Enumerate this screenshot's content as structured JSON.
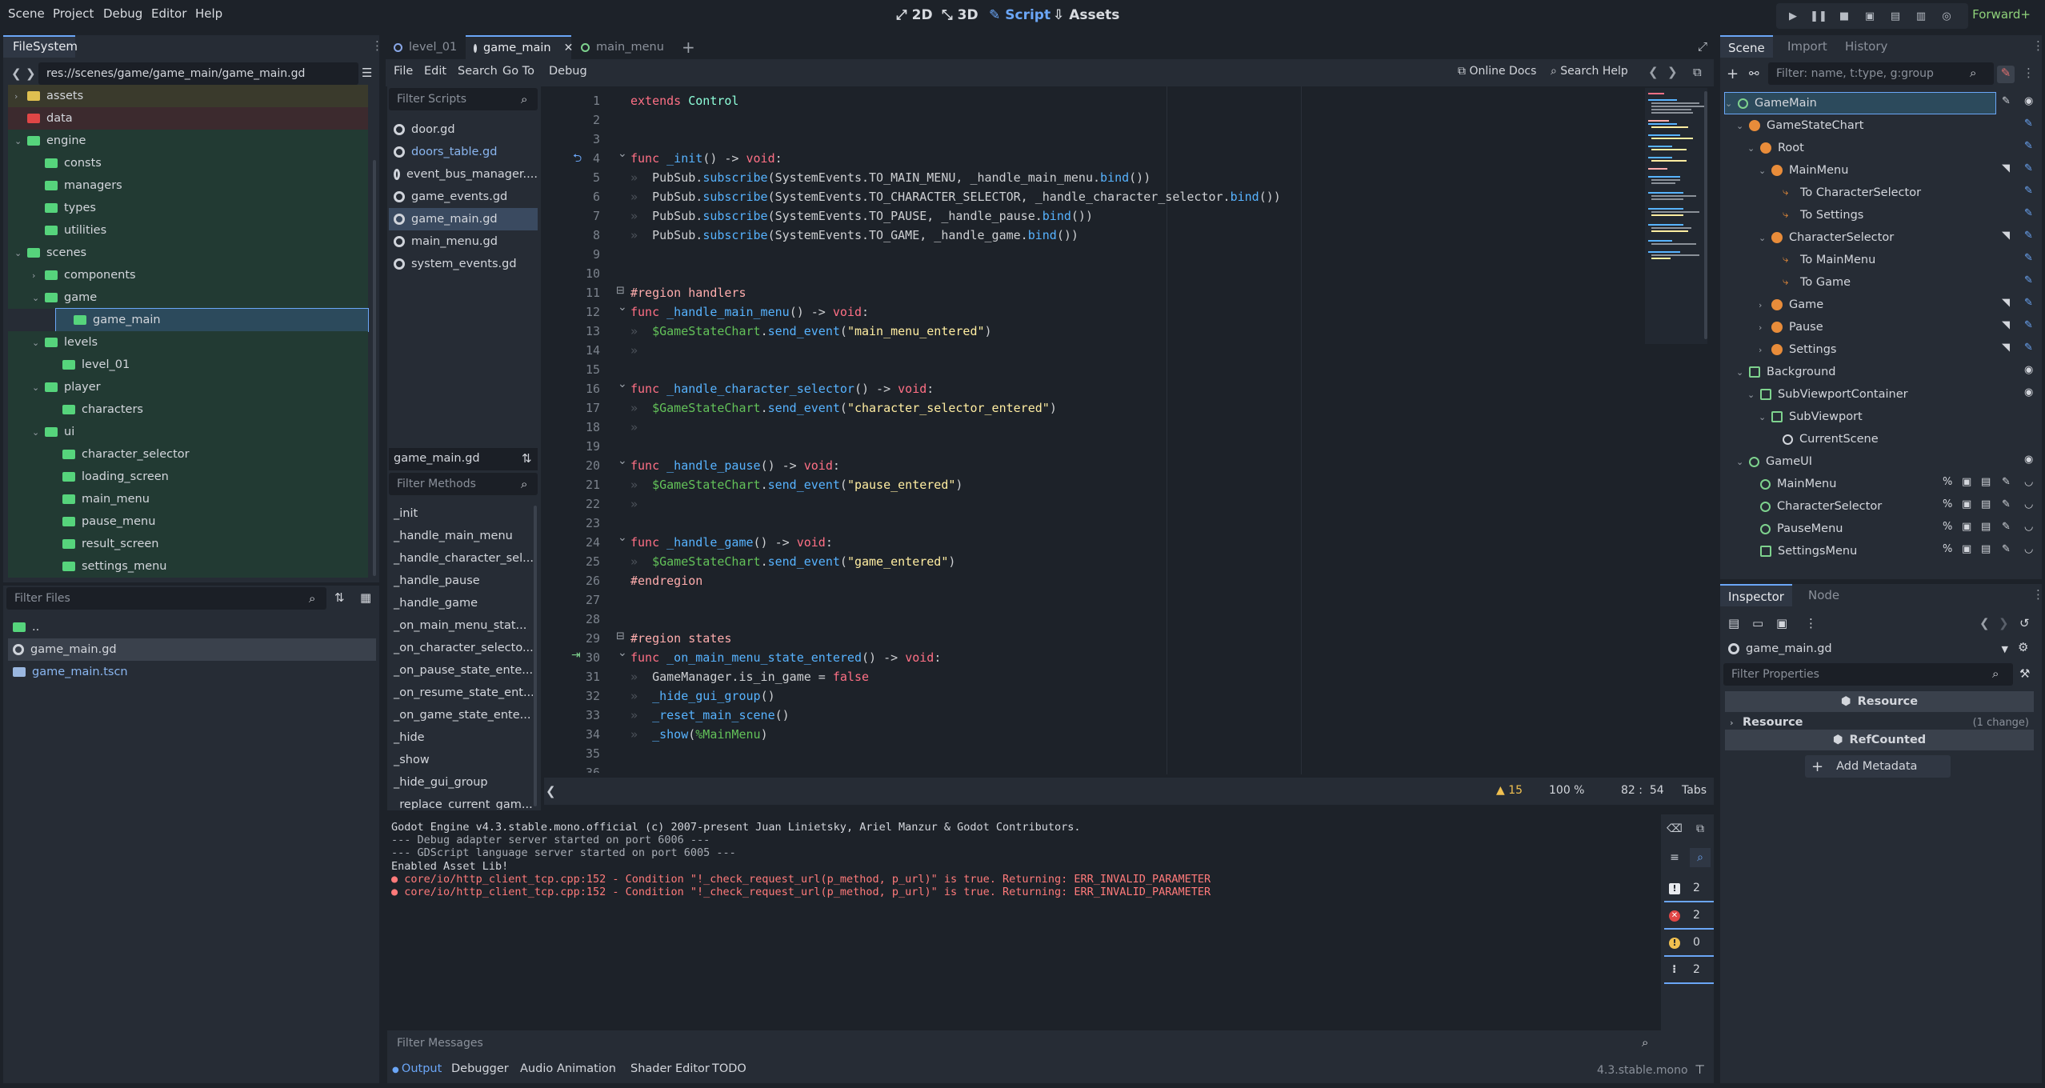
{
  "menubar": {
    "items": [
      "Scene",
      "Project",
      "Debug",
      "Editor",
      "Help"
    ]
  },
  "modes": {
    "d2": "2D",
    "d3": "3D",
    "script": "Script",
    "assets": "Assets"
  },
  "renderer": "Forward+",
  "filesystem": {
    "tab": "FileSystem",
    "path": "res://scenes/game/game_main/game_main.gd",
    "tree": [
      {
        "label": "assets",
        "indent": 1,
        "color": "yellow",
        "chev": ">"
      },
      {
        "label": "data",
        "indent": 1,
        "color": "red",
        "chev": ""
      },
      {
        "label": "engine",
        "indent": 1,
        "color": "green",
        "chev": "v"
      },
      {
        "label": "consts",
        "indent": 2,
        "color": "green",
        "chev": ""
      },
      {
        "label": "managers",
        "indent": 2,
        "color": "green",
        "chev": ""
      },
      {
        "label": "types",
        "indent": 2,
        "color": "green",
        "chev": ""
      },
      {
        "label": "utilities",
        "indent": 2,
        "color": "green",
        "chev": ""
      },
      {
        "label": "scenes",
        "indent": 1,
        "color": "green",
        "chev": "v"
      },
      {
        "label": "components",
        "indent": 2,
        "color": "green",
        "chev": ">"
      },
      {
        "label": "game",
        "indent": 2,
        "color": "green",
        "chev": "v"
      },
      {
        "label": "game_main",
        "indent": 3,
        "color": "green",
        "chev": "",
        "selected": true
      },
      {
        "label": "levels",
        "indent": 2,
        "color": "green",
        "chev": "v"
      },
      {
        "label": "level_01",
        "indent": 3,
        "color": "green",
        "chev": ""
      },
      {
        "label": "player",
        "indent": 2,
        "color": "green",
        "chev": "v"
      },
      {
        "label": "characters",
        "indent": 3,
        "color": "green",
        "chev": ""
      },
      {
        "label": "ui",
        "indent": 2,
        "color": "green",
        "chev": "v"
      },
      {
        "label": "character_selector",
        "indent": 3,
        "color": "green",
        "chev": ""
      },
      {
        "label": "loading_screen",
        "indent": 3,
        "color": "green",
        "chev": ""
      },
      {
        "label": "main_menu",
        "indent": 3,
        "color": "green",
        "chev": ""
      },
      {
        "label": "pause_menu",
        "indent": 3,
        "color": "green",
        "chev": ""
      },
      {
        "label": "result_screen",
        "indent": 3,
        "color": "green",
        "chev": ""
      },
      {
        "label": "settings_menu",
        "indent": 3,
        "color": "green",
        "chev": ""
      }
    ],
    "filter_placeholder": "Filter Files",
    "files": [
      {
        "label": "..",
        "type": "folder"
      },
      {
        "label": "game_main.gd",
        "type": "script",
        "selected": true
      },
      {
        "label": "game_main.tscn",
        "type": "scene"
      }
    ]
  },
  "script_tabs": [
    {
      "label": "level_01"
    },
    {
      "label": "game_main",
      "active": true
    },
    {
      "label": "main_menu"
    }
  ],
  "script_menu": [
    "File",
    "Edit",
    "Search",
    "Go To",
    "Debug"
  ],
  "script_links": {
    "online_docs": "Online Docs",
    "search_help": "Search Help"
  },
  "scripts_panel": {
    "filter_placeholder": "Filter Scripts",
    "items": [
      "door.gd",
      "doors_table.gd",
      "event_bus_manager....",
      "game_events.gd",
      "game_main.gd",
      "main_menu.gd",
      "system_events.gd"
    ],
    "selected_index": 4,
    "current": "game_main.gd",
    "methods_placeholder": "Filter Methods",
    "methods": [
      "_init",
      "_handle_main_menu",
      "_handle_character_sel...",
      "_handle_pause",
      "_handle_game",
      "_on_main_menu_stat...",
      "_on_character_selecto...",
      "_on_pause_state_ente...",
      "_on_resume_state_ent...",
      "_on_game_state_ente...",
      "_hide",
      "_show",
      "_hide_gui_group",
      "_replace_current_gam..."
    ]
  },
  "code": {
    "lines": [
      {
        "n": "1",
        "html": "<span class='kw'>extends</span> <span class='cls'>Control</span>"
      },
      {
        "n": "2",
        "html": ""
      },
      {
        "n": "3",
        "html": ""
      },
      {
        "n": "4",
        "html": "<span class='kw'>func</span> <span class='fn'>_init</span>() -> <span class='kw'>void</span>:",
        "fold": true,
        "gutter": "override"
      },
      {
        "n": "5",
        "html": "<span class='tabm'>»  </span>PubSub.<span class='fn'>subscribe</span>(SystemEvents.TO_MAIN_MENU, _handle_main_menu.<span class='fn'>bind</span>())"
      },
      {
        "n": "6",
        "html": "<span class='tabm'>»  </span>PubSub.<span class='fn'>subscribe</span>(SystemEvents.TO_CHARACTER_SELECTOR, _handle_character_selector.<span class='fn'>bind</span>())"
      },
      {
        "n": "7",
        "html": "<span class='tabm'>»  </span>PubSub.<span class='fn'>subscribe</span>(SystemEvents.TO_PAUSE, _handle_pause.<span class='fn'>bind</span>())"
      },
      {
        "n": "8",
        "html": "<span class='tabm'>»  </span>PubSub.<span class='fn'>subscribe</span>(SystemEvents.TO_GAME, _handle_game.<span class='fn'>bind</span>())"
      },
      {
        "n": "9",
        "html": ""
      },
      {
        "n": "10",
        "html": ""
      },
      {
        "n": "11",
        "html": "<span class='region'>#region handlers</span>",
        "region": true
      },
      {
        "n": "12",
        "html": "<span class='kw'>func</span> <span class='fn'>_handle_main_menu</span>() -> <span class='kw'>void</span>:",
        "fold": true
      },
      {
        "n": "13",
        "html": "<span class='tabm'>»  </span><span class='node'>$GameStateChart</span>.<span class='fn'>send_event</span>(<span class='str'>\"main_menu_entered\"</span>)"
      },
      {
        "n": "14",
        "html": "<span class='tabm'>»</span>"
      },
      {
        "n": "15",
        "html": ""
      },
      {
        "n": "16",
        "html": "<span class='kw'>func</span> <span class='fn'>_handle_character_selector</span>() -> <span class='kw'>void</span>:",
        "fold": true
      },
      {
        "n": "17",
        "html": "<span class='tabm'>»  </span><span class='node'>$GameStateChart</span>.<span class='fn'>send_event</span>(<span class='str'>\"character_selector_entered\"</span>)"
      },
      {
        "n": "18",
        "html": "<span class='tabm'>»</span>"
      },
      {
        "n": "19",
        "html": ""
      },
      {
        "n": "20",
        "html": "<span class='kw'>func</span> <span class='fn'>_handle_pause</span>() -> <span class='kw'>void</span>:",
        "fold": true
      },
      {
        "n": "21",
        "html": "<span class='tabm'>»  </span><span class='node'>$GameStateChart</span>.<span class='fn'>send_event</span>(<span class='str'>\"pause_entered\"</span>)"
      },
      {
        "n": "22",
        "html": "<span class='tabm'>»</span>"
      },
      {
        "n": "23",
        "html": ""
      },
      {
        "n": "24",
        "html": "<span class='kw'>func</span> <span class='fn'>_handle_game</span>() -> <span class='kw'>void</span>:",
        "fold": true
      },
      {
        "n": "25",
        "html": "<span class='tabm'>»  </span><span class='node'>$GameStateChart</span>.<span class='fn'>send_event</span>(<span class='str'>\"game_entered\"</span>)"
      },
      {
        "n": "26",
        "html": "<span class='region'>#endregion</span>"
      },
      {
        "n": "27",
        "html": ""
      },
      {
        "n": "28",
        "html": ""
      },
      {
        "n": "29",
        "html": "<span class='region'>#region states</span>",
        "region": true
      },
      {
        "n": "30",
        "html": "<span class='kw'>func</span> <span class='fn'>_on_main_menu_state_entered</span>() -> <span class='kw'>void</span>:",
        "fold": true,
        "gutter": "signal"
      },
      {
        "n": "31",
        "html": "<span class='tabm'>»  </span>GameManager.is_in_game = <span class='kw'>false</span>"
      },
      {
        "n": "32",
        "html": "<span class='tabm'>»  </span><span class='fn'>_hide_gui_group</span>()"
      },
      {
        "n": "33",
        "html": "<span class='tabm'>»  </span><span class='fn'>_reset_main_scene</span>()"
      },
      {
        "n": "34",
        "html": "<span class='tabm'>»  </span><span class='fn'>_show</span>(<span class='node'>%MainMenu</span>)"
      },
      {
        "n": "35",
        "html": ""
      },
      {
        "n": "36",
        "html": ""
      }
    ]
  },
  "status": {
    "warnings": "15",
    "zoom": "100 %",
    "position": "82 :  54",
    "indent": "Tabs"
  },
  "console": {
    "lines": [
      {
        "text": "Godot Engine v4.3.stable.mono.official (c) 2007-present Juan Linietsky, Ariel Manzur & Godot Contributors.",
        "type": "normal"
      },
      {
        "text": "--- Debug adapter server started on port 6006 ---",
        "type": "dim"
      },
      {
        "text": "--- GDScript language server started on port 6005 ---",
        "type": "dim"
      },
      {
        "text": "Enabled Asset Lib!",
        "type": "normal"
      },
      {
        "text": "core/io/http_client_tcp.cpp:152 - Condition \"!_check_request_url(p_method, p_url)\" is true. Returning: ERR_INVALID_PARAMETER",
        "type": "error"
      },
      {
        "text": "core/io/http_client_tcp.cpp:152 - Condition \"!_check_request_url(p_method, p_url)\" is true. Returning: ERR_INVALID_PARAMETER",
        "type": "error"
      }
    ],
    "filter_placeholder": "Filter Messages",
    "counts": {
      "all": "2",
      "errors": "2",
      "warnings": "0",
      "messages": "2"
    }
  },
  "bottom_tabs": [
    "Output",
    "Debugger",
    "Audio",
    "Animation",
    "Shader Editor",
    "TODO"
  ],
  "version": "4.3.stable.mono",
  "scene_panel": {
    "tabs": [
      "Scene",
      "Import",
      "History"
    ],
    "filter_placeholder": "Filter: name, t:type, g:group",
    "nodes": [
      {
        "label": "GameMain",
        "indent": 0,
        "icon": "circ",
        "chev": "v",
        "selected": true
      },
      {
        "label": "GameStateChart",
        "indent": 1,
        "icon": "orange",
        "chev": "v"
      },
      {
        "label": "Root",
        "indent": 2,
        "icon": "orange",
        "chev": "v"
      },
      {
        "label": "MainMenu",
        "indent": 3,
        "icon": "orange",
        "chev": "v"
      },
      {
        "label": "To CharacterSelector",
        "indent": 4,
        "icon": "arrow",
        "chev": ""
      },
      {
        "label": "To Settings",
        "indent": 4,
        "icon": "arrow",
        "chev": ""
      },
      {
        "label": "CharacterSelector",
        "indent": 3,
        "icon": "orange",
        "chev": "v"
      },
      {
        "label": "To MainMenu",
        "indent": 4,
        "icon": "arrow",
        "chev": ""
      },
      {
        "label": "To Game",
        "indent": 4,
        "icon": "arrow",
        "chev": ""
      },
      {
        "label": "Game",
        "indent": 3,
        "icon": "orange",
        "chev": ">"
      },
      {
        "label": "Pause",
        "indent": 3,
        "icon": "orange",
        "chev": ">"
      },
      {
        "label": "Settings",
        "indent": 3,
        "icon": "orange",
        "chev": ">"
      },
      {
        "label": "Background",
        "indent": 1,
        "icon": "greensq",
        "chev": "v"
      },
      {
        "label": "SubViewportContainer",
        "indent": 2,
        "icon": "greensq",
        "chev": "v"
      },
      {
        "label": "SubViewport",
        "indent": 3,
        "icon": "greensq",
        "chev": "v"
      },
      {
        "label": "CurrentScene",
        "indent": 4,
        "icon": "whitecirc",
        "chev": ""
      },
      {
        "label": "GameUI",
        "indent": 1,
        "icon": "circ",
        "chev": "v"
      },
      {
        "label": "MainMenu",
        "indent": 2,
        "icon": "circ",
        "chev": ""
      },
      {
        "label": "CharacterSelector",
        "indent": 2,
        "icon": "circ",
        "chev": ""
      },
      {
        "label": "PauseMenu",
        "indent": 2,
        "icon": "circ",
        "chev": ""
      },
      {
        "label": "SettingsMenu",
        "indent": 2,
        "icon": "greensq",
        "chev": ""
      }
    ]
  },
  "inspector": {
    "tabs": [
      "Inspector",
      "Node"
    ],
    "resource": "game_main.gd",
    "filter_placeholder": "Filter Properties",
    "section_resource": "Resource",
    "group_resource": "Resource",
    "group_change": "(1 change)",
    "section_refcounted": "RefCounted",
    "add_metadata": "Add Metadata"
  }
}
